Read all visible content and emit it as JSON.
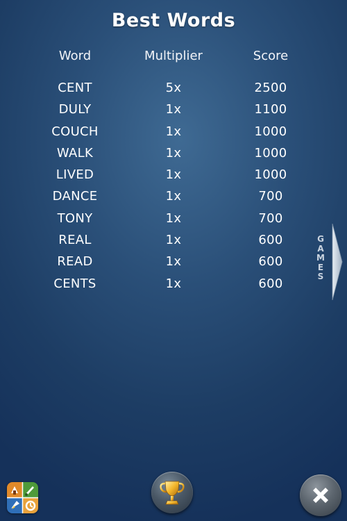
{
  "page": {
    "title": "Best Words"
  },
  "table": {
    "headers": {
      "word": "Word",
      "multiplier": "Multiplier",
      "score": "Score"
    },
    "rows": [
      {
        "word": "CENT",
        "multiplier": "5x",
        "score": "2500"
      },
      {
        "word": "DULY",
        "multiplier": "1x",
        "score": "1100"
      },
      {
        "word": "COUCH",
        "multiplier": "1x",
        "score": "1000"
      },
      {
        "word": "WALK",
        "multiplier": "1x",
        "score": "1000"
      },
      {
        "word": "LIVED",
        "multiplier": "1x",
        "score": "1000"
      },
      {
        "word": "DANCE",
        "multiplier": "1x",
        "score": "700"
      },
      {
        "word": "TONY",
        "multiplier": "1x",
        "score": "700"
      },
      {
        "word": "REAL",
        "multiplier": "1x",
        "score": "600"
      },
      {
        "word": "READ",
        "multiplier": "1x",
        "score": "600"
      },
      {
        "word": "CENTS",
        "multiplier": "1x",
        "score": "600"
      }
    ]
  },
  "side_tab": {
    "label": "GAMES"
  },
  "bottom_bar": {
    "app_icon": "app-icon",
    "trophy_icon": "trophy-icon",
    "close_icon": "close-icon"
  },
  "colors": {
    "background": "#1d3d64",
    "text": "#ffffff"
  }
}
